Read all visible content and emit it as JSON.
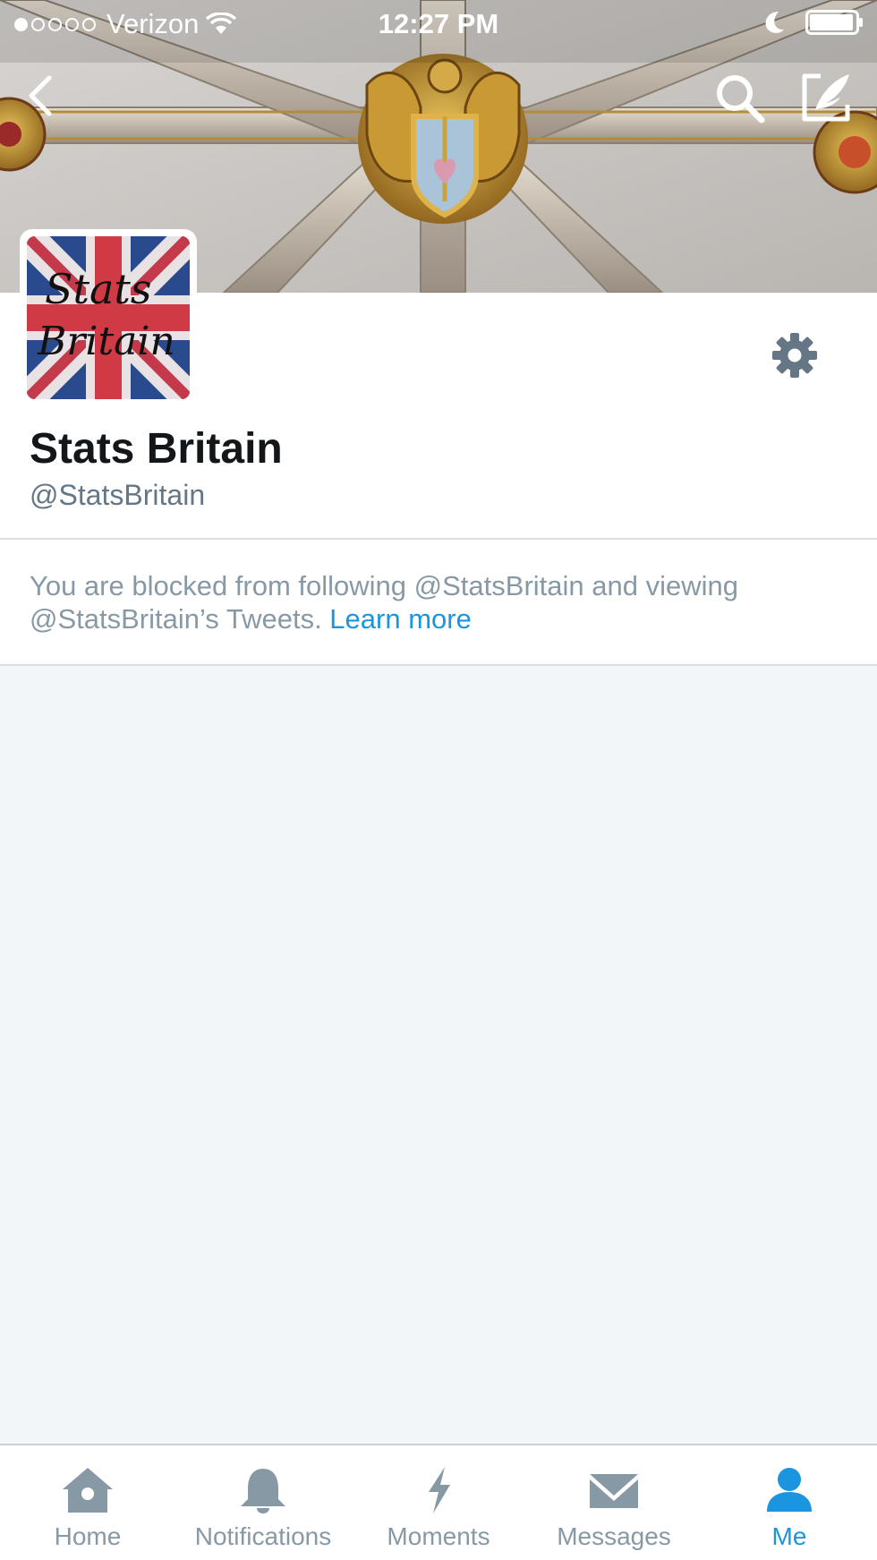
{
  "status_bar": {
    "carrier": "Verizon",
    "time": "12:27 PM",
    "signal_bars_filled": 1,
    "signal_bars_total": 5
  },
  "profile": {
    "avatar_text_line1": "Stats",
    "avatar_text_line2": "Britain",
    "display_name": "Stats Britain",
    "handle": "@StatsBritain"
  },
  "notice": {
    "message": "You are blocked from following @StatsBritain and viewing @StatsBritain’s Tweets.",
    "link_label": "Learn more"
  },
  "tabs": [
    {
      "label": "Home",
      "icon": "home-icon",
      "active": false
    },
    {
      "label": "Notifications",
      "icon": "bell-icon",
      "active": false
    },
    {
      "label": "Moments",
      "icon": "lightning-icon",
      "active": false
    },
    {
      "label": "Messages",
      "icon": "envelope-icon",
      "active": false
    },
    {
      "label": "Me",
      "icon": "person-icon",
      "active": true
    }
  ],
  "colors": {
    "accent": "#1b95e0",
    "inactive": "#8899a6",
    "background": "#f3f6f9"
  }
}
